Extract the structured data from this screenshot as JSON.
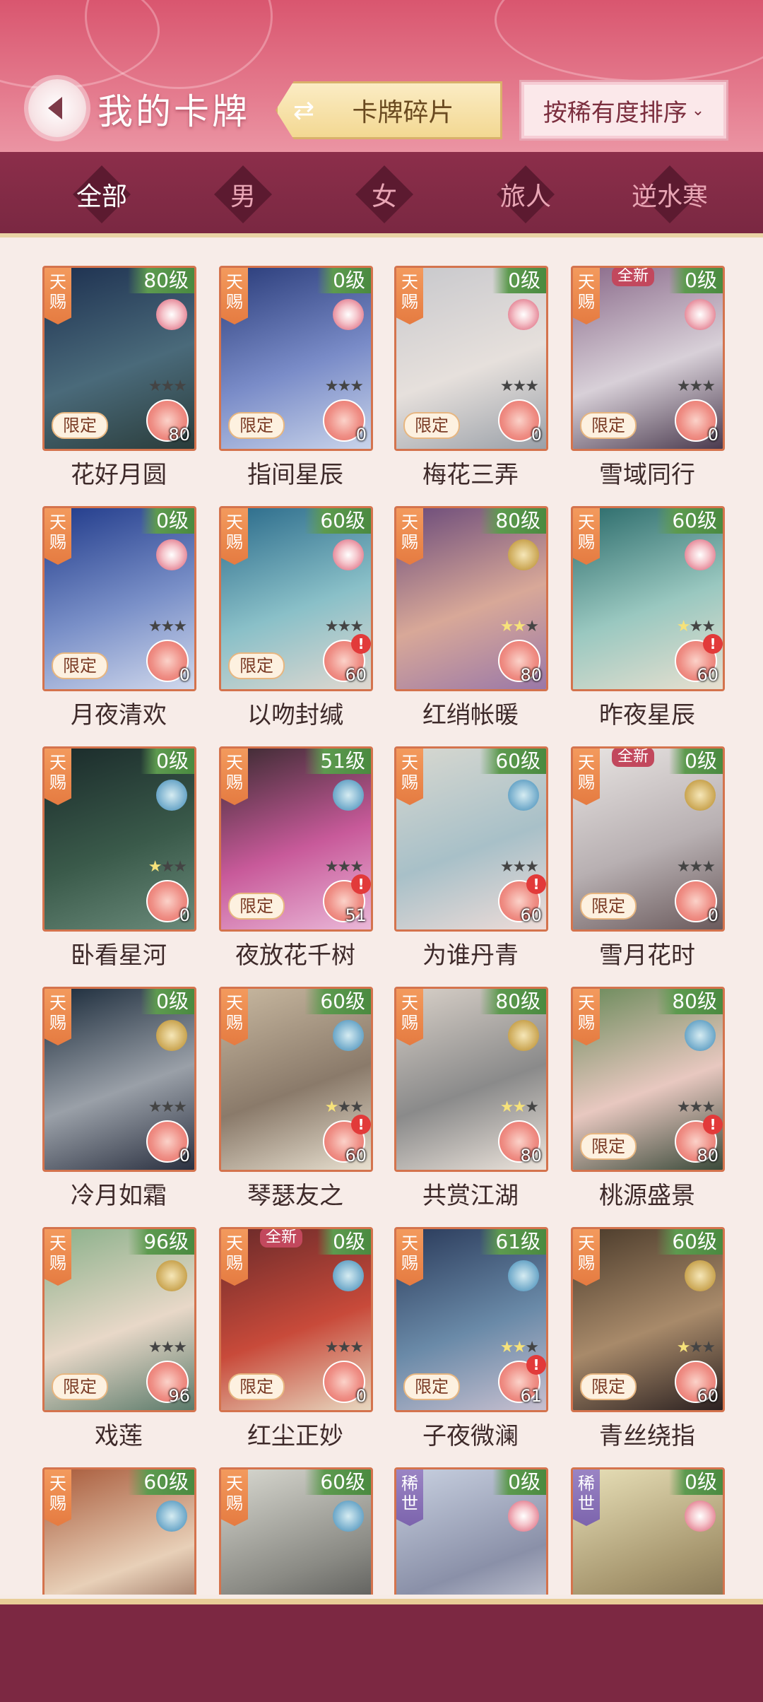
{
  "header": {
    "title": "我的卡牌",
    "fragments_label": "卡牌碎片",
    "sort_label": "按稀有度排序"
  },
  "filters": [
    "全部",
    "男",
    "女",
    "旅人",
    "逆水寒"
  ],
  "active_filter": 0,
  "colors": {
    "header": "#d9566f",
    "filter_bar": "#7a2842",
    "card_border": "#d4734d",
    "level_banner": "#4a8a40",
    "rarity_tianci": "#e57b41",
    "rarity_xishi": "#7c64ad"
  },
  "cards": [
    {
      "name": "花好月圆",
      "rarity": "天赐",
      "level": "80级",
      "count": "80",
      "limited": "限定",
      "stars": 0,
      "alert": false,
      "new": false,
      "attr": "flower-icon",
      "bg": [
        "#1d3050",
        "#4a6a7a",
        "#2a3c3a"
      ]
    },
    {
      "name": "指间星辰",
      "rarity": "天赐",
      "level": "0级",
      "count": "0",
      "limited": "限定",
      "stars": 0,
      "alert": false,
      "new": false,
      "attr": "flower-icon",
      "bg": [
        "#2a3c7a",
        "#7a8cc8",
        "#c9d4ea"
      ]
    },
    {
      "name": "梅花三弄",
      "rarity": "天赐",
      "level": "0级",
      "count": "0",
      "limited": "限定",
      "stars": 0,
      "alert": false,
      "new": false,
      "attr": "flower-icon",
      "bg": [
        "#c8c8cc",
        "#e6e0dc",
        "#9aa0a8"
      ]
    },
    {
      "name": "雪域同行",
      "rarity": "天赐",
      "level": "0级",
      "count": "0",
      "limited": "限定",
      "stars": 0,
      "alert": false,
      "new": true,
      "new_label": "全新",
      "attr": "flower-icon",
      "bg": [
        "#8a6a8a",
        "#d8d0d8",
        "#4a3a4e"
      ]
    },
    {
      "name": "月夜清欢",
      "rarity": "天赐",
      "level": "0级",
      "count": "0",
      "limited": "限定",
      "stars": 0,
      "alert": false,
      "new": false,
      "attr": "flower-icon",
      "bg": [
        "#203a8a",
        "#7a90c8",
        "#d0d8ec"
      ]
    },
    {
      "name": "以吻封缄",
      "rarity": "天赐",
      "level": "60级",
      "count": "60",
      "limited": "限定",
      "stars": 0,
      "alert": true,
      "new": false,
      "attr": "flower-icon",
      "bg": [
        "#2a6a8a",
        "#8ac0c8",
        "#e0d8d0"
      ]
    },
    {
      "name": "红绡帐暖",
      "rarity": "天赐",
      "level": "80级",
      "count": "80",
      "limited": "",
      "stars": 2,
      "alert": false,
      "new": false,
      "attr": "coin-icon",
      "bg": [
        "#6a4a7a",
        "#d8a898",
        "#9a78a8"
      ]
    },
    {
      "name": "昨夜星辰",
      "rarity": "天赐",
      "level": "60级",
      "count": "60",
      "limited": "",
      "stars": 1,
      "alert": true,
      "new": false,
      "attr": "flower-icon",
      "bg": [
        "#2a6a6a",
        "#9ac8c0",
        "#e8e0d0"
      ]
    },
    {
      "name": "卧看星河",
      "rarity": "天赐",
      "level": "0级",
      "count": "0",
      "limited": "",
      "stars": 1,
      "alert": false,
      "new": false,
      "attr": "fan-icon",
      "bg": [
        "#1a2a2a",
        "#3a5a4a",
        "#6a8a7a"
      ]
    },
    {
      "name": "夜放花千树",
      "rarity": "天赐",
      "level": "51级",
      "count": "51",
      "limited": "限定",
      "stars": 0,
      "alert": true,
      "new": false,
      "attr": "fan-icon",
      "bg": [
        "#3a2a30",
        "#c85a9a",
        "#eab8d8"
      ]
    },
    {
      "name": "为谁丹青",
      "rarity": "天赐",
      "level": "60级",
      "count": "60",
      "limited": "",
      "stars": 0,
      "alert": true,
      "new": false,
      "attr": "fan-icon",
      "bg": [
        "#d8d8d0",
        "#a8c0c8",
        "#eedcd8"
      ]
    },
    {
      "name": "雪月花时",
      "rarity": "天赐",
      "level": "0级",
      "count": "0",
      "limited": "限定",
      "stars": 0,
      "alert": false,
      "new": true,
      "new_label": "全新",
      "attr": "coin-icon",
      "bg": [
        "#e8e4e2",
        "#b8b0b2",
        "#6a5a5c"
      ]
    },
    {
      "name": "冷月如霜",
      "rarity": "天赐",
      "level": "0级",
      "count": "0",
      "limited": "",
      "stars": 0,
      "alert": false,
      "new": false,
      "attr": "coin-icon",
      "bg": [
        "#1a2a3a",
        "#9aa0a8",
        "#2a3040"
      ]
    },
    {
      "name": "琴瑟友之",
      "rarity": "天赐",
      "level": "60级",
      "count": "60",
      "limited": "",
      "stars": 1,
      "alert": true,
      "new": false,
      "attr": "fan-icon",
      "bg": [
        "#c8b8a0",
        "#8a7a6a",
        "#e8e0d0"
      ]
    },
    {
      "name": "共赏江湖",
      "rarity": "天赐",
      "level": "80级",
      "count": "80",
      "limited": "",
      "stars": 2,
      "alert": false,
      "new": false,
      "attr": "coin-icon",
      "bg": [
        "#d8d0c8",
        "#8a8a8a",
        "#ece4dc"
      ]
    },
    {
      "name": "桃源盛景",
      "rarity": "天赐",
      "level": "80级",
      "count": "80",
      "limited": "限定",
      "stars": 0,
      "alert": true,
      "new": false,
      "attr": "fan-icon",
      "bg": [
        "#6a8a5a",
        "#e8c8c0",
        "#3a4a3a"
      ]
    },
    {
      "name": "戏莲",
      "rarity": "天赐",
      "level": "96级",
      "count": "96",
      "limited": "限定",
      "stars": 0,
      "alert": false,
      "new": false,
      "attr": "coin-icon",
      "bg": [
        "#8ab08a",
        "#e8d8c8",
        "#5a7a6a"
      ]
    },
    {
      "name": "红尘正妙",
      "rarity": "天赐",
      "level": "0级",
      "count": "0",
      "limited": "限定",
      "stars": 0,
      "alert": false,
      "new": true,
      "new_label": "全新",
      "attr": "fan-icon",
      "bg": [
        "#6a2a2a",
        "#c84a3a",
        "#e8d8c0"
      ]
    },
    {
      "name": "子夜微澜",
      "rarity": "天赐",
      "level": "61级",
      "count": "61",
      "limited": "限定",
      "stars": 2,
      "alert": true,
      "new": false,
      "attr": "fan-icon",
      "bg": [
        "#2a3a5a",
        "#6a8aa8",
        "#c8c0d0"
      ]
    },
    {
      "name": "青丝绕指",
      "rarity": "天赐",
      "level": "60级",
      "count": "60",
      "limited": "限定",
      "stars": 1,
      "alert": false,
      "new": false,
      "attr": "coin-icon",
      "bg": [
        "#4a3a2a",
        "#a88a6a",
        "#2a2020"
      ]
    },
    {
      "name": "",
      "rarity": "天赐",
      "level": "60级",
      "count": "",
      "limited": "",
      "stars": 0,
      "alert": false,
      "new": false,
      "attr": "fan-icon",
      "bg": [
        "#a85a3a",
        "#e8d0b8",
        "#6a3a2a"
      ]
    },
    {
      "name": "",
      "rarity": "天赐",
      "level": "60级",
      "count": "",
      "limited": "",
      "stars": 0,
      "alert": false,
      "new": false,
      "attr": "fan-icon",
      "bg": [
        "#d8d8d0",
        "#8a8a84",
        "#3a3a3a"
      ]
    },
    {
      "name": "",
      "rarity": "稀世",
      "level": "0级",
      "count": "",
      "limited": "",
      "stars": 0,
      "alert": false,
      "new": false,
      "attr": "flower-icon",
      "bg": [
        "#c8d0e0",
        "#8a90a8",
        "#eaeaf0"
      ]
    },
    {
      "name": "",
      "rarity": "稀世",
      "level": "0级",
      "count": "",
      "limited": "",
      "stars": 0,
      "alert": false,
      "new": false,
      "attr": "flower-icon",
      "bg": [
        "#e8e0b8",
        "#a89870",
        "#6a5a40"
      ]
    }
  ]
}
